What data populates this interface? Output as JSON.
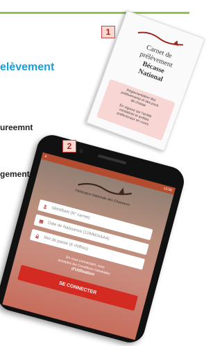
{
  "heading": "elèvement",
  "bullets": [
    "ureemnt",
    "gement"
  ],
  "badges": [
    "1",
    "2"
  ],
  "card1": {
    "title_lines": [
      "Carnet de",
      "prélèvement",
      "Bécasse",
      "National"
    ],
    "info_lines": [
      "Réglementation des",
      "prélèvements et des jours",
      "de chasse",
      "",
      "En vigueur sur l'arrêté",
      "ministériel et arrêtés",
      "préfectoraux en cours"
    ]
  },
  "phone": {
    "status_left": "≡",
    "status_right": "10:00",
    "subtitle": "Fédération Nationale des Chasseurs",
    "fields": [
      "Identifiant (N° carnet)",
      "Date de Naissance (JJ/MM/AAAA)",
      "Mot de passe (6 chiffres)"
    ],
    "notice_line1": "En vous connectant, vous",
    "notice_line2": "acceptez les Conditions Générales",
    "notice_bold": "d'Utilisation",
    "cta_label": "SE CONNECTER"
  },
  "colors": {
    "heading_blue": "#1a9ed9",
    "accent_green": "#8bc64a",
    "brand_red": "#d32b21",
    "status_bar": "#b34b2e"
  },
  "icons": [
    "logo-bird-icon",
    "user-icon",
    "calendar-icon",
    "lock-icon"
  ]
}
